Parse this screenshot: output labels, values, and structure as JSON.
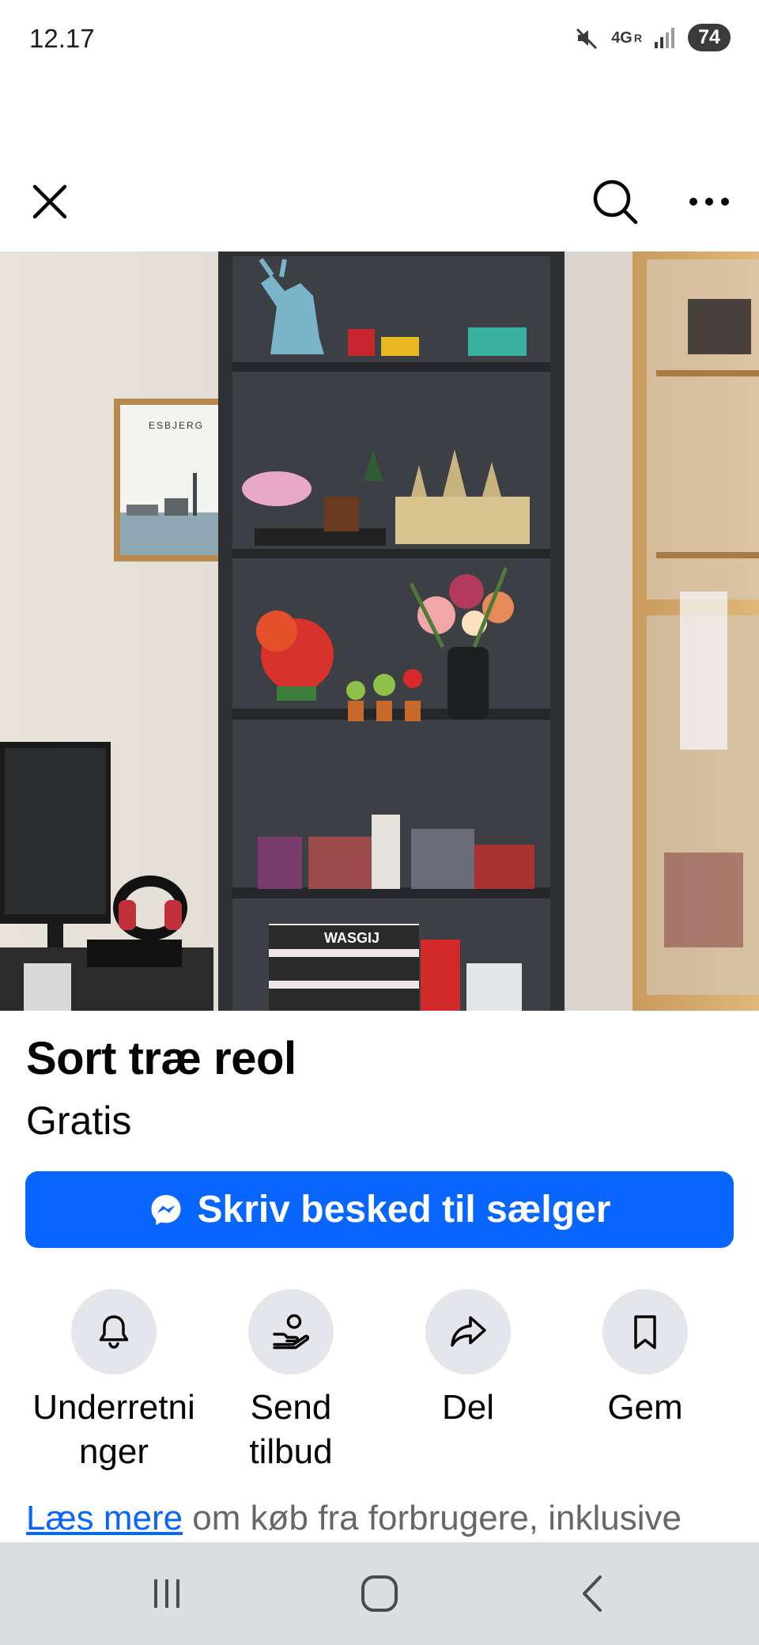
{
  "status_bar": {
    "time": "12.17",
    "network": "4G",
    "network_sub": "R",
    "battery": "74",
    "icons": [
      "mute-icon",
      "signal-icon"
    ]
  },
  "top_nav": {
    "icons": [
      "close-icon",
      "search-icon",
      "more-icon"
    ]
  },
  "photo": {
    "poster_text": "ESBJERG",
    "box_text": "WASGIJ"
  },
  "listing": {
    "title": "Sort træ reol",
    "price": "Gratis"
  },
  "message_button": {
    "label": "Skriv besked til sælger",
    "icon": "messenger-icon",
    "color": "#0866ff"
  },
  "actions": [
    {
      "label_line1": "Underretni",
      "label_line2": "nger",
      "icon": "bell-icon"
    },
    {
      "label_line1": "Send",
      "label_line2": "tilbud",
      "icon": "offer-icon"
    },
    {
      "label_line1": "Del",
      "label_line2": "",
      "icon": "share-icon"
    },
    {
      "label_line1": "Gem",
      "label_line2": "",
      "icon": "bookmark-icon"
    }
  ],
  "info": {
    "link_text": "Læs mere",
    "rest_text": " om køb fra forbrugere, inklusive"
  },
  "system_nav": {
    "icons": [
      "recent-apps-icon",
      "home-icon",
      "back-icon"
    ]
  }
}
